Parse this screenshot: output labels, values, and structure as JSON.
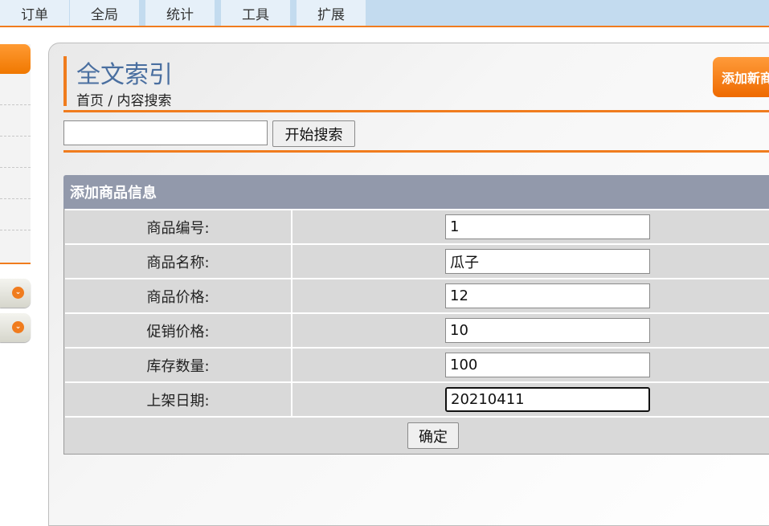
{
  "top_nav": [
    "订单",
    "全局",
    "统计",
    "工具",
    "扩展"
  ],
  "page": {
    "title": "全文索引",
    "breadcrumb": "首页 / 内容搜索",
    "add_new_label": "添加新商品"
  },
  "search": {
    "value": "",
    "button_label": "开始搜索"
  },
  "form": {
    "header": "添加商品信息",
    "fields": [
      {
        "label": "商品编号:",
        "value": "1"
      },
      {
        "label": "商品名称:",
        "value": "瓜子"
      },
      {
        "label": "商品价格:",
        "value": "12"
      },
      {
        "label": "促销价格:",
        "value": "10"
      },
      {
        "label": "库存数量:",
        "value": "100"
      },
      {
        "label": "上架日期:",
        "value": "20210411"
      }
    ],
    "submit_label": "确定"
  },
  "colors": {
    "accent": "#f07c1e",
    "topbar": "#c3dbef",
    "form_header": "#9299ab",
    "title": "#4a6fa0"
  }
}
